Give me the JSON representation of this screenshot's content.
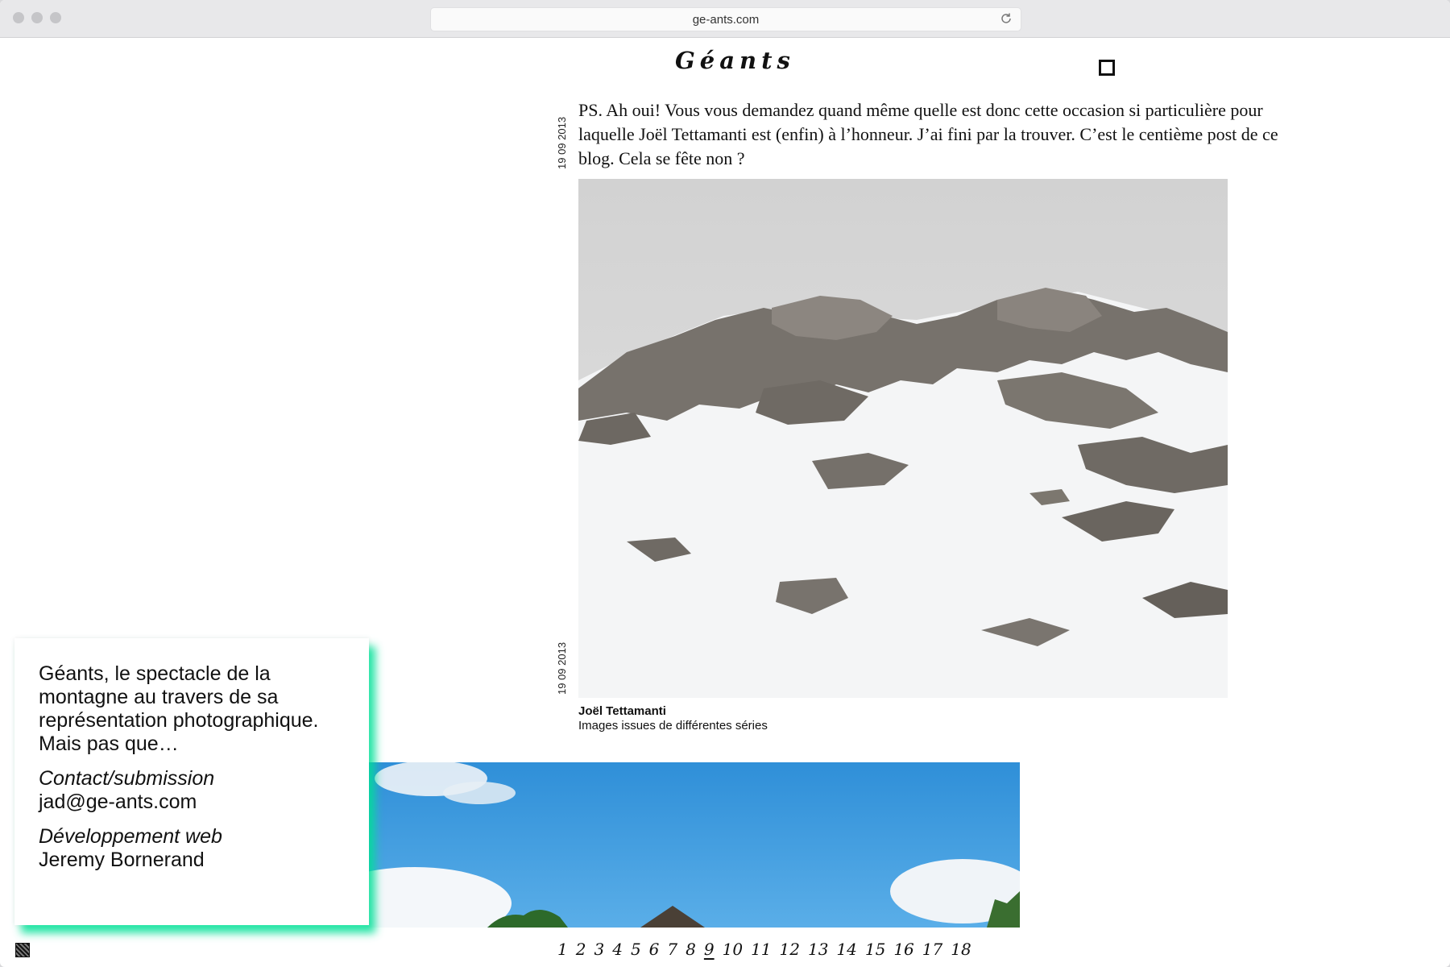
{
  "browser": {
    "url": "ge-ants.com"
  },
  "header": {
    "site_title": "Géants"
  },
  "post": {
    "date": "19 09 2013",
    "text": "PS. Ah oui! Vous vous demandez quand même quelle est donc cette occasion si particulière pour laquelle Joël Tettamanti est (enfin) à l’honneur. J’ai fini par la trouver. C’est le centième post de ce blog. Cela se fête non ?"
  },
  "photo_post": {
    "date": "19 09 2013",
    "caption_author": "Joël Tettamanti",
    "caption_text": "Images issues de différentes séries"
  },
  "info": {
    "intro": "Géants, le spectacle de la montagne au travers de sa représentation photographique. Mais pas que…",
    "contact_label": "Contact/submission",
    "contact_email": "jad@ge-ants.com",
    "dev_label": "Développement web",
    "dev_name": "Jeremy Bornerand"
  },
  "pagination": {
    "pages": [
      "1",
      "2",
      "3",
      "4",
      "5",
      "6",
      "7",
      "8",
      "9",
      "10",
      "11",
      "12",
      "13",
      "14",
      "15",
      "16",
      "17",
      "18"
    ],
    "current": "9"
  },
  "colors": {
    "accent_glow": "#00e096"
  }
}
